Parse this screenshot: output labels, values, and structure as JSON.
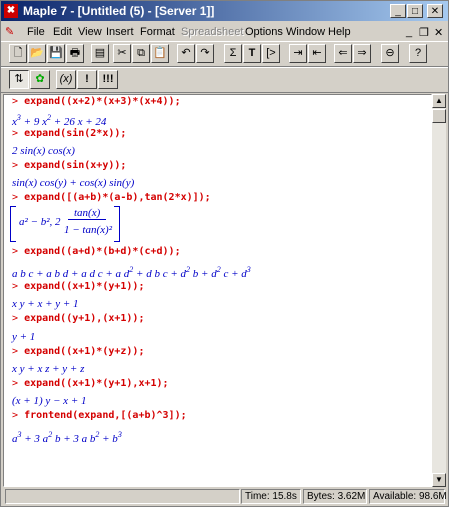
{
  "window": {
    "title": "Maple 7 - [Untitled (5) - [Server 1]]",
    "app_icon": "maple-leaf-icon"
  },
  "menubar": {
    "items": [
      "File",
      "Edit",
      "View",
      "Insert",
      "Format",
      "Spreadsheet",
      "Options",
      "Window",
      "Help"
    ],
    "disabled": [
      "Spreadsheet"
    ]
  },
  "toolbar1": [
    "new-file-icon",
    "open-folder-icon",
    "save-icon",
    "print-icon",
    "cut-icon",
    "copy-icon",
    "paste-icon",
    "undo-icon",
    "redo-icon",
    "sigma-icon",
    "T",
    "[>",
    "indent-icon",
    "outdent-icon",
    "back-icon",
    "forward-icon",
    "stop-icon",
    "help-icon"
  ],
  "toolbar1_labels": {
    "sigma": "Σ",
    "text": "T",
    "prompt": "[>"
  },
  "toolbar2_labels": {
    "xy": "(x)",
    "exec": "!",
    "execall": "!!!"
  },
  "worksheet": {
    "prompt": ">",
    "lines": [
      {
        "kind": "input",
        "text": "expand((x+2)*(x+3)*(x+4));"
      },
      {
        "kind": "output",
        "html": "x<sup>3</sup> + 9 x<sup>2</sup> + 26 x + 24"
      },
      {
        "kind": "input",
        "text": "expand(sin(2*x));"
      },
      {
        "kind": "output",
        "text": "2 sin(x) cos(x)"
      },
      {
        "kind": "input",
        "text": "expand(sin(x+y));"
      },
      {
        "kind": "output",
        "text": "sin(x) cos(y) + cos(x) sin(y)"
      },
      {
        "kind": "input",
        "text": "expand([(a+b)*(a-b),tan(2*x)]);"
      },
      {
        "kind": "matrix",
        "left": "a² − b², 2",
        "num": "tan(x)",
        "den": "1 − tan(x)²"
      },
      {
        "kind": "input",
        "text": "expand((a+d)*(b+d)*(c+d));"
      },
      {
        "kind": "output",
        "html": "a b c + a b d + a d c + a d<sup>2</sup> + d b c + d<sup>2</sup> b + d<sup>2</sup> c + d<sup>3</sup>"
      },
      {
        "kind": "input",
        "text": "expand((x+1)*(y+1));"
      },
      {
        "kind": "output",
        "text": "x y + x + y + 1"
      },
      {
        "kind": "input",
        "text": "expand((y+1),(x+1));"
      },
      {
        "kind": "output",
        "text": "y + 1"
      },
      {
        "kind": "input",
        "text": "expand((x+1)*(y+z));"
      },
      {
        "kind": "output",
        "text": "x y + x z + y + z"
      },
      {
        "kind": "input",
        "text": "expand((x+1)*(y+1),x+1);"
      },
      {
        "kind": "output",
        "text": "(x + 1) y − x + 1"
      },
      {
        "kind": "input",
        "text": "frontend(expand,[(a+b)^3]);"
      },
      {
        "kind": "output",
        "html": "a<sup>3</sup> + 3 a<sup>2</sup> b + 3 a b<sup>2</sup> + b<sup>3</sup>"
      }
    ]
  },
  "status": {
    "time": "Time: 15.8s",
    "bytes": "Bytes: 3.62M",
    "available": "Available: 98.6M"
  }
}
